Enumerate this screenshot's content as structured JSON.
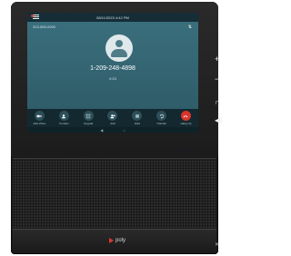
{
  "status_bar": {
    "datetime": "08/11/2023 4:42 PM"
  },
  "call": {
    "line_label": "323-555-0000",
    "caller_number": "1-209-248-4898",
    "elapsed": "0:23"
  },
  "actions": [
    {
      "label": "Add Video",
      "icon": "video-icon"
    },
    {
      "label": "Contact",
      "icon": "contact-icon"
    },
    {
      "label": "Keypad",
      "icon": "keypad-icon"
    },
    {
      "label": "Add",
      "icon": "add-person-icon"
    },
    {
      "label": "Hold",
      "icon": "pause-icon"
    },
    {
      "label": "Transfer",
      "icon": "transfer-icon"
    },
    {
      "label": "Hang Up",
      "icon": "hangup-icon"
    }
  ],
  "brand": {
    "logo_text": "poly",
    "accent": "#e0362c"
  },
  "colors": {
    "screen_bg": "#2f5d69",
    "hangup": "#d9342b"
  }
}
